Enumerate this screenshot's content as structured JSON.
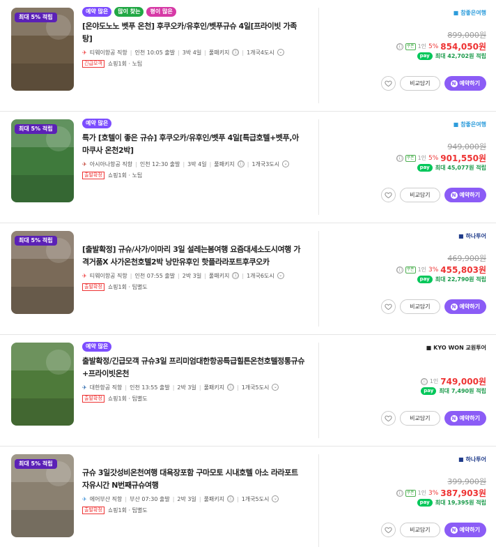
{
  "icons": {
    "info": "ⓘ",
    "chevron": "⌄",
    "naver": "N"
  },
  "items": [
    {
      "thumb_color": "#6b5a44",
      "point_badge": "최대 5% 적립",
      "tags": [
        {
          "label": "예약 많은",
          "color": "#7c4dff"
        },
        {
          "label": "많이 찾는",
          "color": "#22a845"
        },
        {
          "label": "평이 많은",
          "color": "#d63aa6"
        }
      ],
      "title": "[온야도노노 벳푸 온천] 후쿠오카/유후인/벳푸규슈 4일[프라이빗 가족탕]",
      "airline": "티웨이항공 직항",
      "air_color": "#e33",
      "departure": "인천 10:05 출발",
      "duration": "3박 4일",
      "package": "풀패키지",
      "region": "1개국4도시",
      "badge": "긴급모객",
      "sub": "쇼핑1회 · 노팁",
      "agency": "참좋은여행",
      "agency_color": "#2d9cdb",
      "original_price": "899,000원",
      "coupon": "쿠폰",
      "per_person": "1인",
      "discount": "5%",
      "price": "854,050원",
      "npay_label": "pay",
      "points": "최대 42,702원 적립",
      "compare": "비교담기",
      "book": "예약하기"
    },
    {
      "thumb_color": "#3f7a3c",
      "point_badge": "최대 5% 적립",
      "tags": [
        {
          "label": "예약 많은",
          "color": "#7c4dff"
        }
      ],
      "title": "특가 [호텔이 좋은 규슈] 후쿠오카/유후인/벳푸 4일[특급호텔+벳푸,아마쿠사 온천2박]",
      "airline": "아시아나항공 직항",
      "air_color": "#c0392b",
      "departure": "인천 12:30 출발",
      "duration": "3박 4일",
      "package": "풀패키지",
      "region": "1개국3도시",
      "badge": "출발확정",
      "sub": "쇼핑1회 · 노팁",
      "agency": "참좋은여행",
      "agency_color": "#2d9cdb",
      "original_price": "949,000원",
      "coupon": "쿠폰",
      "per_person": "1인",
      "discount": "5%",
      "price": "901,550원",
      "npay_label": "pay",
      "points": "최대 45,077원 적립",
      "compare": "비교담기",
      "book": "예약하기"
    },
    {
      "thumb_color": "#7a6a58",
      "point_badge": "최대 5% 적립",
      "tags": [],
      "title": "[출발확정] 규슈/사가/이마리 3일 설레는봄여행 요즘대세소도시여행 가격거품X 사가온천호텔2박 낭만유후인 핫플라라포트후쿠오카",
      "airline": "티웨이항공 직항",
      "air_color": "#e33",
      "departure": "인천 07:55 출발",
      "duration": "2박 3일",
      "package": "풀패키지",
      "region": "1개국6도시",
      "badge": "출발확정",
      "sub": "쇼핑1회 · 팁별도",
      "agency": "하나투어",
      "agency_color": "#1f3b8a",
      "original_price": "469,900원",
      "coupon": "쿠폰",
      "per_person": "1인",
      "discount": "3%",
      "price": "455,803원",
      "npay_label": "pay",
      "points": "최대 22,790원 적립",
      "compare": "비교담기",
      "book": "예약하기"
    },
    {
      "thumb_color": "#4e7a3a",
      "point_badge": "",
      "tags": [
        {
          "label": "예약 많은",
          "color": "#7c4dff"
        }
      ],
      "title": "출발확정/긴급모객 규슈3일 프리미엄대한항공특급힐튼온천호텔정통규슈+프라이빗온천",
      "airline": "대한항공 직항",
      "air_color": "#1f5fa8",
      "departure": "인천 13:55 출발",
      "duration": "2박 3일",
      "package": "풀패키지",
      "region": "1개국5도시",
      "badge": "출발확정",
      "sub": "쇼핑1회 · 팁별도",
      "agency": "KYO WON 교원투어",
      "agency_color": "#222",
      "original_price": "",
      "coupon": "",
      "per_person": "1인",
      "discount": "",
      "price": "749,000원",
      "npay_label": "pay",
      "points": "최대 7,490원 적립",
      "compare": "비교담기",
      "book": "예약하기"
    },
    {
      "thumb_color": "#8a8070",
      "point_badge": "최대 5% 적립",
      "tags": [],
      "title": "규슈 3일갓성비온천여행 대욕장포함 구마모토 시내호텔 아소 라라포트 자유시간 N번째규슈여행",
      "airline": "에어부산 직항",
      "air_color": "#3a8fd6",
      "departure": "부산 07:30 출발",
      "duration": "2박 3일",
      "package": "풀패키지",
      "region": "1개국5도시",
      "badge": "출발확정",
      "sub": "쇼핑1회 · 팁별도",
      "agency": "하나투어",
      "agency_color": "#1f3b8a",
      "original_price": "399,900원",
      "coupon": "쿠폰",
      "per_person": "1인",
      "discount": "3%",
      "price": "387,903원",
      "npay_label": "pay",
      "points": "최대 19,395원 적립",
      "compare": "비교담기",
      "book": "예약하기"
    }
  ]
}
